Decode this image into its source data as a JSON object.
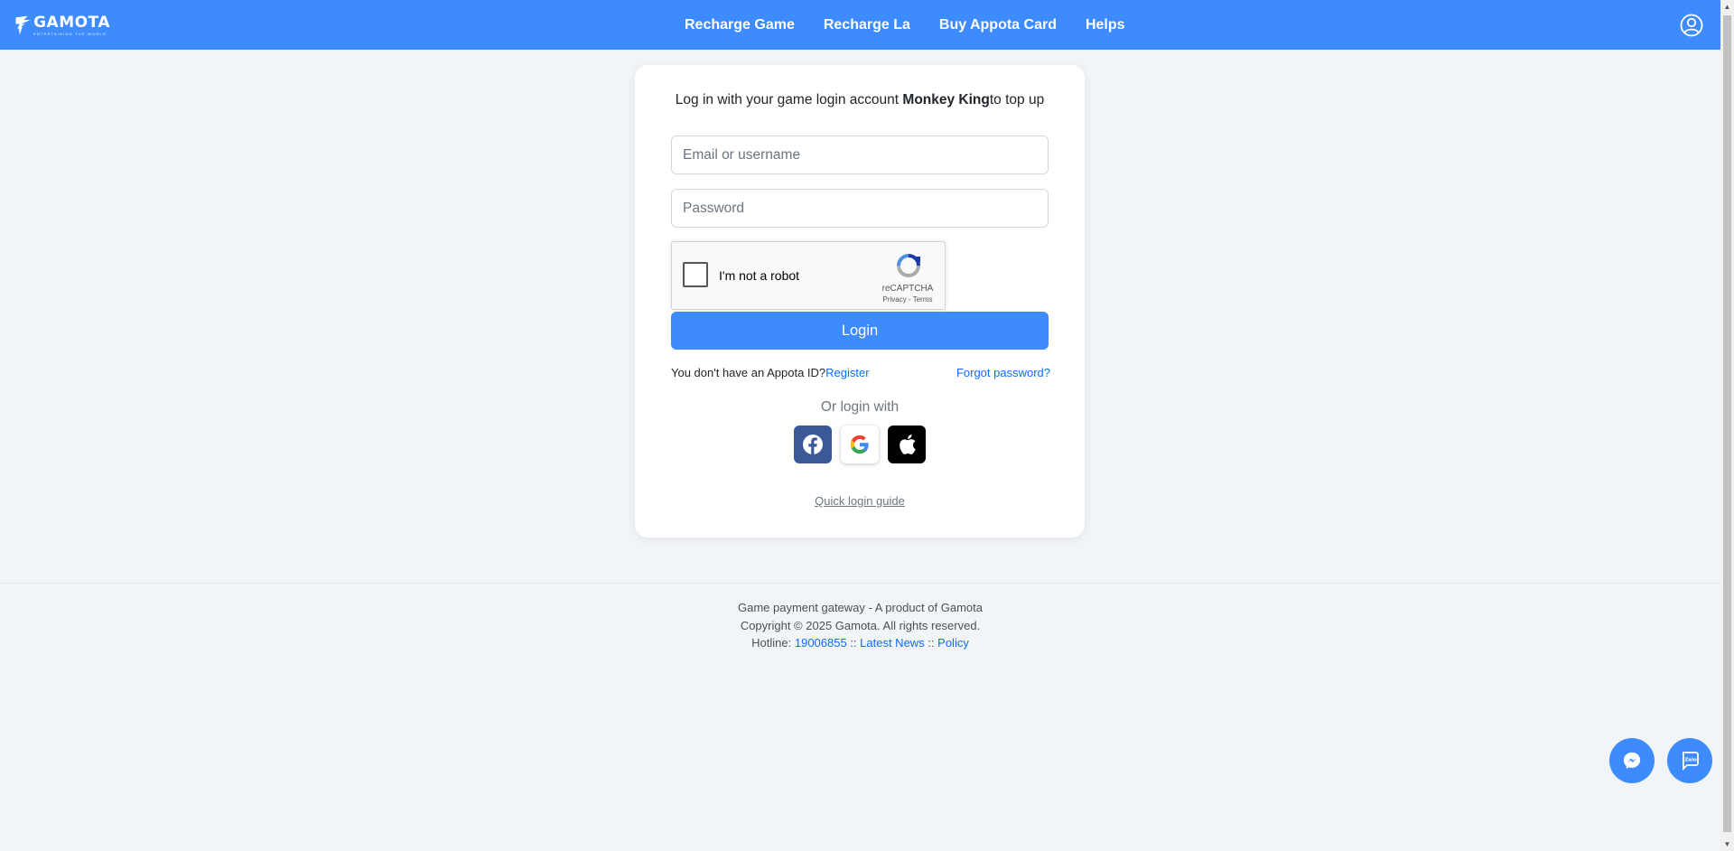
{
  "header": {
    "logo": {
      "text": "GAMOTA",
      "tagline": "ENTERTAINING THE WORLD"
    },
    "nav": [
      "Recharge Game",
      "Recharge La",
      "Buy Appota Card",
      "Helps"
    ],
    "user_icon": "user-circle-icon"
  },
  "login": {
    "title_prefix": "Log in with your game login account ",
    "game_name": "Monkey King",
    "title_suffix": "to top up",
    "email_placeholder": "Email or username",
    "password_placeholder": "Password",
    "recaptcha": {
      "label": "I'm not a robot",
      "brand": "reCAPTCHA",
      "links": "Privacy - Terms"
    },
    "login_button": "Login",
    "no_account_text": "You don't have an Appota ID?",
    "register_link": "Register",
    "forgot_link": "Forgot password?",
    "or_login_with": "Or login with",
    "social": [
      "facebook-icon",
      "google-icon",
      "apple-icon"
    ],
    "quick_guide": "Quick login guide"
  },
  "footer": {
    "line1": "Game payment gateway - A product of Gamota",
    "line2": "Copyright © 2025 Gamota. All rights reserved.",
    "hotline_label": "Hotline: ",
    "hotline": "19006855",
    "sep": " :: ",
    "latest_news": "Latest News",
    "policy": "Policy"
  },
  "floating": [
    "messenger-icon",
    "zalo-icon"
  ],
  "colors": {
    "primary": "#3d8bfd",
    "background": "#f2f5f8",
    "link": "#0d6efd",
    "facebook": "#3b5998"
  }
}
